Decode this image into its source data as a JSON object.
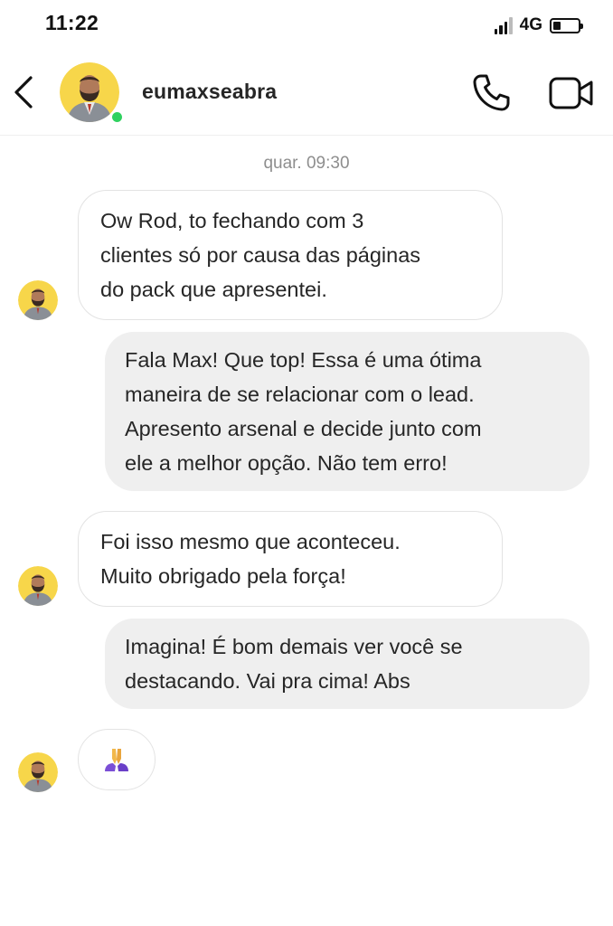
{
  "status_bar": {
    "time": "11:22",
    "network": "4G",
    "battery_level": 0.3
  },
  "header": {
    "username": "eumaxseabra",
    "online": true,
    "icons": [
      "back-icon",
      "phone-icon",
      "video-camera-icon"
    ]
  },
  "chat": {
    "timestamp": "quar. 09:30",
    "messages": [
      {
        "direction": "incoming",
        "lines": [
          "Ow Rod, to fechando com 3",
          "clientes só por causa das páginas",
          "do pack que apresentei."
        ]
      },
      {
        "direction": "outgoing",
        "lines": [
          "Fala Max! Que top! Essa é uma ótima",
          "maneira de se relacionar com o lead.",
          "Apresento arsenal e decide junto com",
          "ele a melhor opção. Não tem erro!"
        ]
      },
      {
        "direction": "incoming",
        "lines": [
          "Foi isso mesmo que aconteceu.",
          "Muito obrigado pela força!"
        ]
      },
      {
        "direction": "outgoing",
        "lines": [
          "Imagina! É bom demais ver você se",
          "destacando. Vai pra cima! Abs"
        ]
      },
      {
        "direction": "incoming",
        "emoji": "folded-hands-emoji"
      }
    ]
  },
  "colors": {
    "incoming_bubble": "#ffffff",
    "outgoing_bubble": "#efefef",
    "online_dot": "#2fd15f",
    "avatar_bg": "#f7d64a"
  }
}
